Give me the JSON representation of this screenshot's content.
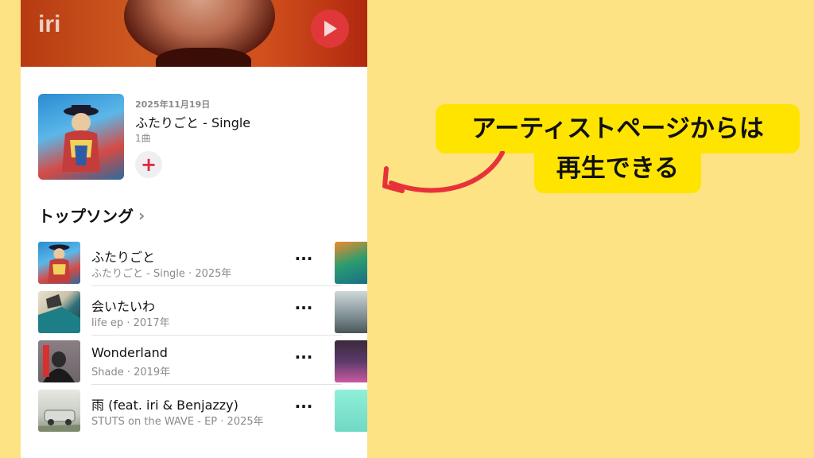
{
  "artist": {
    "name": "iri"
  },
  "latest_release": {
    "date": "2025年11月19日",
    "title": "ふたりごと - Single",
    "track_count": "1曲",
    "add_label": "+"
  },
  "top_songs": {
    "heading": "トップソング",
    "chevron": "›",
    "songs": [
      {
        "title": "ふたりごと",
        "subtitle": "ふたりごと - Single · 2025年",
        "more": "···"
      },
      {
        "title": "会いたいわ",
        "subtitle": "life ep · 2017年",
        "more": "···"
      },
      {
        "title": "Wonderland",
        "subtitle": "Shade · 2019年",
        "more": "···"
      },
      {
        "title": "雨 (feat. iri & Benjazzy)",
        "subtitle": "STUTS on the WAVE - EP · 2025年",
        "more": "···"
      }
    ]
  },
  "annotation": {
    "line1": "アーティストページからは",
    "line2": "再生できる"
  },
  "colors": {
    "background": "#FDE384",
    "callout": "#FFE400",
    "accent_red": "#E0263B",
    "arrow": "#E8323A"
  },
  "icons": {
    "hero_play": "play-icon",
    "add": "plus-icon",
    "more": "ellipsis-icon",
    "section_chevron": "chevron-right-icon"
  }
}
